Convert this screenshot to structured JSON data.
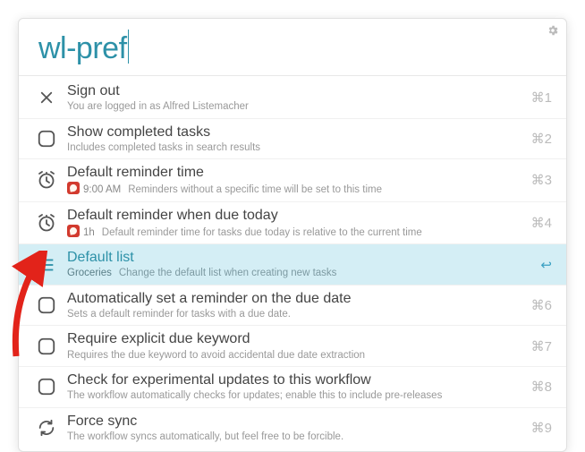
{
  "search": {
    "query": "wl-pref"
  },
  "items": [
    {
      "id": "sign-out",
      "icon": "close",
      "title": "Sign out",
      "subtitle": "You are logged in as Alfred Listemacher",
      "shortcut": "⌘1"
    },
    {
      "id": "show-completed",
      "icon": "checkbox",
      "title": "Show completed tasks",
      "subtitle": "Includes completed tasks in search results",
      "shortcut": "⌘2"
    },
    {
      "id": "default-reminder-time",
      "icon": "alarm",
      "title": "Default reminder time",
      "prefix": "9:00 AM",
      "subtitle": "Reminders without a specific time will be set to this time",
      "shortcut": "⌘3",
      "badge": true
    },
    {
      "id": "default-reminder-today",
      "icon": "alarm",
      "title": "Default reminder when due today",
      "prefix": "1h",
      "subtitle": "Default reminder time for tasks due today is relative to the current time",
      "shortcut": "⌘4",
      "badge": true
    },
    {
      "id": "default-list",
      "icon": "list",
      "title": "Default list",
      "prefix": "Groceries",
      "subtitle": "Change the default list when creating new tasks",
      "shortcut": "↩",
      "selected": true
    },
    {
      "id": "auto-reminder",
      "icon": "checkbox",
      "title": "Automatically set a reminder on the due date",
      "subtitle": "Sets a default reminder for tasks with a due date.",
      "shortcut": "⌘6"
    },
    {
      "id": "require-due-keyword",
      "icon": "checkbox",
      "title": "Require explicit due keyword",
      "subtitle": "Requires the due keyword to avoid accidental due date extraction",
      "shortcut": "⌘7"
    },
    {
      "id": "check-updates",
      "icon": "checkbox",
      "title": "Check for experimental updates to this workflow",
      "subtitle": "The workflow automatically checks for updates; enable this to include pre-releases",
      "shortcut": "⌘8"
    },
    {
      "id": "force-sync",
      "icon": "sync",
      "title": "Force sync",
      "subtitle": "The workflow syncs automatically, but feel free to be forcible.",
      "shortcut": "⌘9"
    }
  ]
}
